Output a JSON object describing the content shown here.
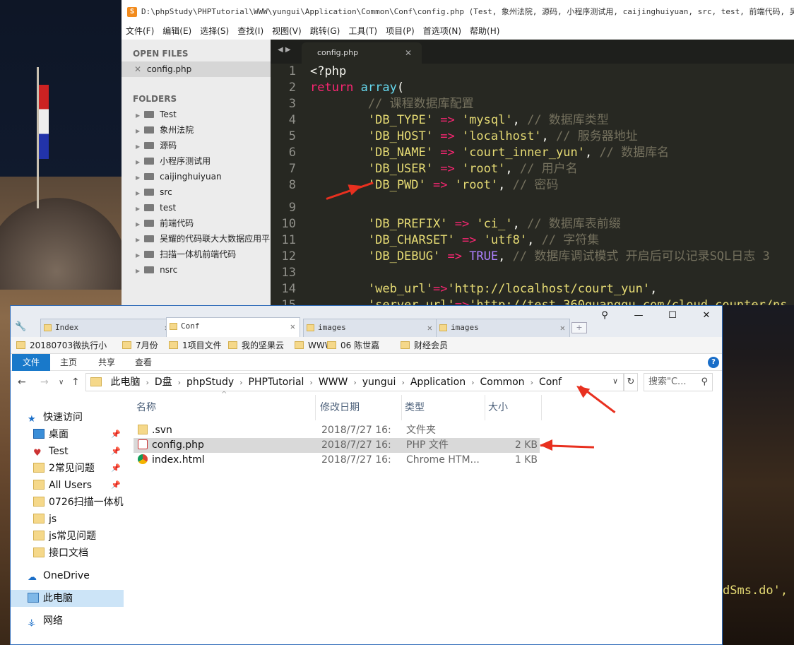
{
  "sublime": {
    "title": "D:\\phpStudy\\PHPTutorial\\WWW\\yungui\\Application\\Common\\Conf\\config.php (Test, 象州法院, 源码, 小程序测试用, caijinghuiyuan, src, test, 前端代码, 吴耀的代码",
    "menu": [
      "文件(F)",
      "编辑(E)",
      "选择(S)",
      "查找(I)",
      "视图(V)",
      "跳转(G)",
      "工具(T)",
      "项目(P)",
      "首选项(N)",
      "帮助(H)"
    ],
    "open_files_label": "OPEN FILES",
    "open_file": "config.php",
    "folders_label": "FOLDERS",
    "folders": [
      "Test",
      "象州法院",
      "源码",
      "小程序测试用",
      "caijinghuiyuan",
      "src",
      "test",
      "前端代码",
      "吴耀的代码联大大数据应用平",
      "扫描一体机前端代码",
      "nsrc"
    ],
    "tab": "config.php",
    "code": [
      {
        "n": "1",
        "parts": [
          [
            "white",
            "<?php"
          ]
        ]
      },
      {
        "n": "2",
        "parts": [
          [
            "pink",
            "return "
          ],
          [
            "cyan",
            "array"
          ],
          [
            "white",
            "("
          ]
        ]
      },
      {
        "n": "3",
        "parts": [
          [
            "gray",
            "        // 课程数据库配置"
          ]
        ]
      },
      {
        "n": "4",
        "parts": [
          [
            "yellow",
            "        'DB_TYPE'"
          ],
          [
            "pink",
            " => "
          ],
          [
            "yellow",
            "'mysql'"
          ],
          [
            "white",
            ", "
          ],
          [
            "gray",
            "// 数据库类型"
          ]
        ]
      },
      {
        "n": "5",
        "parts": [
          [
            "yellow",
            "        'DB_HOST'"
          ],
          [
            "pink",
            " => "
          ],
          [
            "yellow",
            "'localhost'"
          ],
          [
            "white",
            ", "
          ],
          [
            "gray",
            "// 服务器地址"
          ]
        ]
      },
      {
        "n": "6",
        "parts": [
          [
            "yellow",
            "        'DB_NAME'"
          ],
          [
            "pink",
            " => "
          ],
          [
            "yellow",
            "'court_inner_yun'"
          ],
          [
            "white",
            ", "
          ],
          [
            "gray",
            "// 数据库名"
          ]
        ]
      },
      {
        "n": "7",
        "parts": [
          [
            "yellow",
            "        'DB_USER'"
          ],
          [
            "pink",
            " => "
          ],
          [
            "yellow",
            "'root'"
          ],
          [
            "white",
            ", "
          ],
          [
            "gray",
            "// 用户名"
          ]
        ]
      },
      {
        "n": "8",
        "parts": [
          [
            "yellow",
            "        'DB_PWD'"
          ],
          [
            "pink",
            " => "
          ],
          [
            "yellow",
            "'root'"
          ],
          [
            "white",
            ", "
          ],
          [
            "gray",
            "// 密码"
          ]
        ]
      },
      {
        "n": "9",
        "parts": []
      },
      {
        "n": "10",
        "parts": [
          [
            "yellow",
            "        'DB_PREFIX'"
          ],
          [
            "pink",
            " => "
          ],
          [
            "yellow",
            "'ci_'"
          ],
          [
            "white",
            ", "
          ],
          [
            "gray",
            "// 数据库表前缀"
          ]
        ]
      },
      {
        "n": "11",
        "parts": [
          [
            "yellow",
            "        'DB_CHARSET'"
          ],
          [
            "pink",
            " => "
          ],
          [
            "yellow",
            "'utf8'"
          ],
          [
            "white",
            ", "
          ],
          [
            "gray",
            "// 字符集"
          ]
        ]
      },
      {
        "n": "12",
        "parts": [
          [
            "yellow",
            "        'DB_DEBUG'"
          ],
          [
            "pink",
            " => "
          ],
          [
            "purple",
            "TRUE"
          ],
          [
            "white",
            ", "
          ],
          [
            "gray",
            "// 数据库调试模式 开启后可以记录SQL日志 3"
          ]
        ]
      },
      {
        "n": "13",
        "parts": []
      },
      {
        "n": "14",
        "parts": [
          [
            "yellow",
            "        'web_url'"
          ],
          [
            "pink",
            "=>"
          ],
          [
            "yellow",
            "'http://localhost/court_yun'"
          ],
          [
            "white",
            ","
          ]
        ]
      },
      {
        "n": "15",
        "parts": [
          [
            "yellow",
            "        'server_url'"
          ],
          [
            "pink",
            "=>"
          ],
          [
            "yellow",
            "'http://test.360guanggu.com/cloud_counter/ns"
          ]
        ]
      }
    ],
    "peek_text": "dSms.do',"
  },
  "explorer": {
    "tabs": [
      "Index",
      "Conf",
      "images",
      "images"
    ],
    "active_tab": 1,
    "window_controls": [
      "⚲",
      "—",
      "☐",
      "✕"
    ],
    "bookmarks": [
      "20180703微执行小",
      "7月份",
      "1项目文件",
      "我的坚果云",
      "WWW",
      "06 陈世嘉",
      "财经会员"
    ],
    "ribbon": [
      "文件",
      "主页",
      "共享",
      "查看"
    ],
    "breadcrumbs": [
      "此电脑",
      "D盘",
      "phpStudy",
      "PHPTutorial",
      "WWW",
      "yungui",
      "Application",
      "Common",
      "Conf"
    ],
    "search_placeholder": "搜索\"C...",
    "nav": [
      {
        "label": "快速访问",
        "icon": "star-icon",
        "pinned": false
      },
      {
        "label": "桌面",
        "icon": "desktop-icon",
        "pinned": true
      },
      {
        "label": "Test",
        "icon": "vscode-icon",
        "pinned": true
      },
      {
        "label": "2常见问题",
        "icon": "folder-icon",
        "pinned": true
      },
      {
        "label": "All Users",
        "icon": "folder-icon",
        "pinned": true
      },
      {
        "label": "0726扫描一体机",
        "icon": "folder-check-icon",
        "pinned": false
      },
      {
        "label": "js",
        "icon": "folder-error-icon",
        "pinned": false
      },
      {
        "label": "js常见问题",
        "icon": "folder-icon",
        "pinned": false
      },
      {
        "label": "接口文档",
        "icon": "folder-check-icon",
        "pinned": false
      },
      {
        "label": "OneDrive",
        "icon": "cloud-icon",
        "pinned": false
      },
      {
        "label": "此电脑",
        "icon": "computer-icon",
        "pinned": false
      },
      {
        "label": "网络",
        "icon": "network-icon",
        "pinned": false
      }
    ],
    "columns": [
      "名称",
      "修改日期",
      "类型",
      "大小"
    ],
    "files": [
      {
        "name": ".svn",
        "date": "2018/7/27 16:",
        "type": "文件夹",
        "size": "",
        "icon": "folder-icon"
      },
      {
        "name": "config.php",
        "date": "2018/7/27 16:",
        "type": "PHP 文件",
        "size": "2 KB",
        "icon": "php-error-icon"
      },
      {
        "name": "index.html",
        "date": "2018/7/27 16:",
        "type": "Chrome HTM...",
        "size": "1 KB",
        "icon": "chrome-icon"
      }
    ]
  },
  "colors": {
    "annotation_red": "#e8301f",
    "selection_blue": "#cce4f7",
    "file_tab_blue": "#1979ca"
  }
}
